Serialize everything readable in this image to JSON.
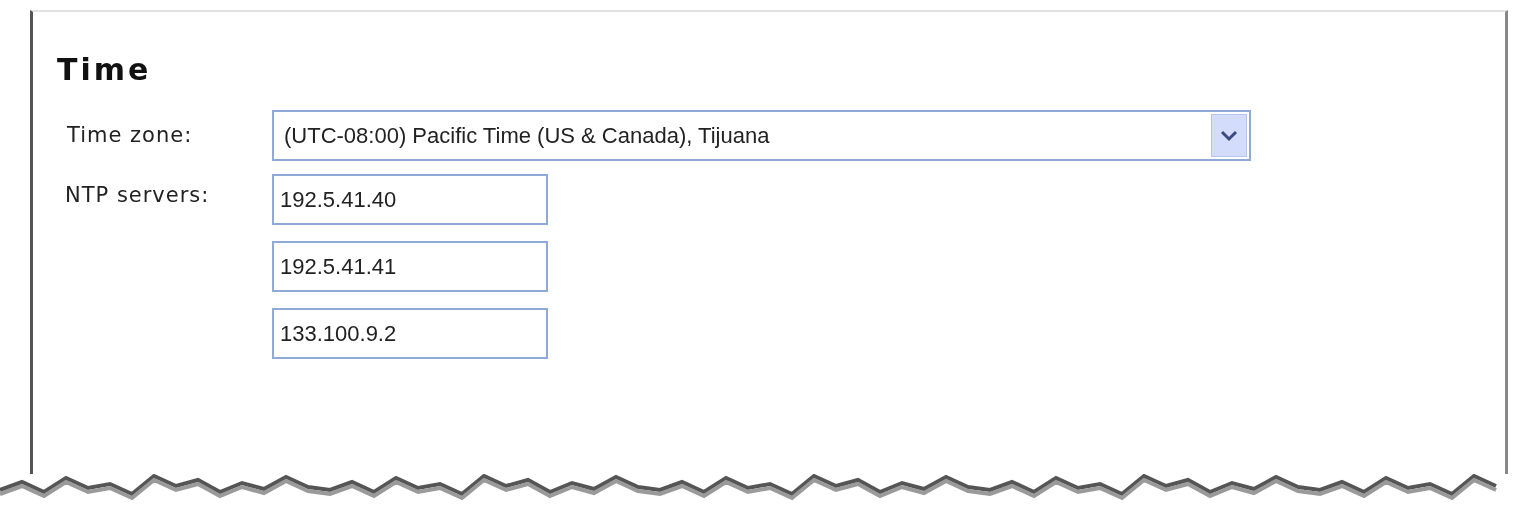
{
  "section": {
    "title": "Time"
  },
  "time_zone": {
    "label": "Time zone:",
    "value": "(UTC-08:00) Pacific Time (US & Canada), Tijuana"
  },
  "ntp_servers": {
    "label": "NTP servers:",
    "values": [
      "192.5.41.40",
      "192.5.41.41",
      "133.100.9.2"
    ]
  }
}
